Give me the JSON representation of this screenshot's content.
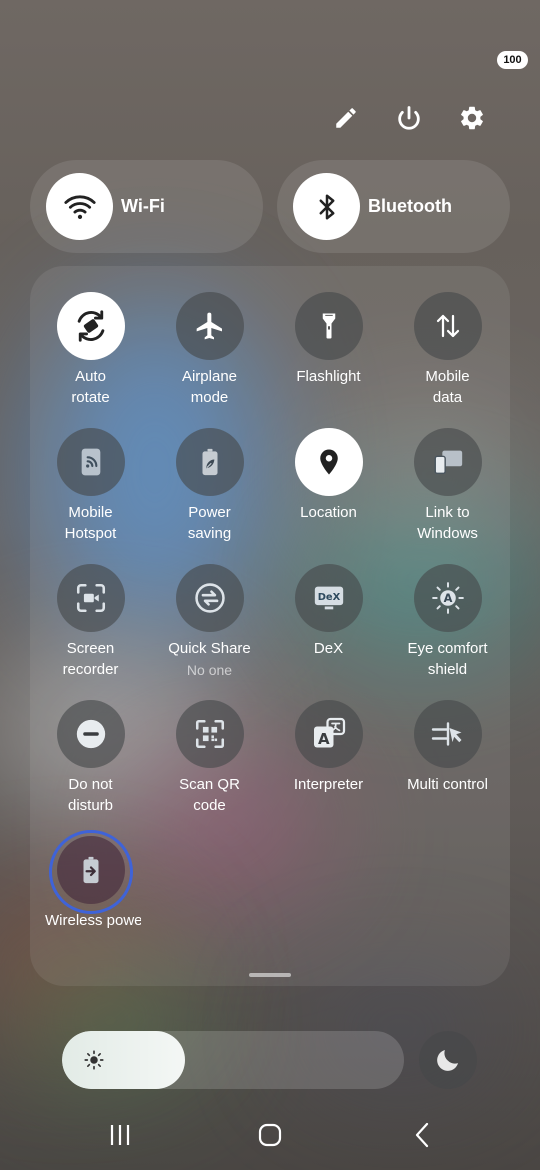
{
  "status": {
    "battery": "100"
  },
  "header_icons": [
    "pencil-icon",
    "power-icon",
    "gear-icon"
  ],
  "wifi": {
    "label": "Wi-Fi",
    "icon": "wifi-icon",
    "on": true
  },
  "bluetooth": {
    "label": "Bluetooth",
    "icon": "bluetooth-icon",
    "on": true
  },
  "tiles": [
    {
      "id": "auto-rotate",
      "label": "Auto\nrotate",
      "icon": "auto-rotate-icon",
      "on": true
    },
    {
      "id": "airplane-mode",
      "label": "Airplane\nmode",
      "icon": "airplane-icon",
      "on": false
    },
    {
      "id": "flashlight",
      "label": "Flashlight",
      "icon": "flashlight-icon",
      "on": false
    },
    {
      "id": "mobile-data",
      "label": "Mobile\ndata",
      "icon": "mobile-data-icon",
      "on": false
    },
    {
      "id": "mobile-hotspot",
      "label": "Mobile\nHotspot",
      "icon": "hotspot-icon",
      "on": false
    },
    {
      "id": "power-saving",
      "label": "Power\nsaving",
      "icon": "battery-leaf-icon",
      "on": false
    },
    {
      "id": "location",
      "label": "Location",
      "icon": "location-pin-icon",
      "on": true
    },
    {
      "id": "link-to-windows",
      "label": "Link to\nWindows",
      "icon": "link-windows-icon",
      "on": false
    },
    {
      "id": "screen-recorder",
      "label": "Screen\nrecorder",
      "icon": "screen-recorder-icon",
      "on": false
    },
    {
      "id": "quick-share",
      "label": "Quick Share",
      "sub": "No one",
      "icon": "quick-share-icon",
      "on": false
    },
    {
      "id": "dex",
      "label": "DeX",
      "icon": "dex-icon",
      "on": false
    },
    {
      "id": "eye-comfort",
      "label": "Eye comfort\nshield",
      "icon": "eye-comfort-icon",
      "on": false
    },
    {
      "id": "do-not-disturb",
      "label": "Do not\ndisturb",
      "icon": "do-not-disturb-icon",
      "on": false
    },
    {
      "id": "scan-qr",
      "label": "Scan QR\ncode",
      "icon": "qr-code-icon",
      "on": false
    },
    {
      "id": "interpreter",
      "label": "Interpreter",
      "icon": "interpreter-icon",
      "on": false
    },
    {
      "id": "multi-control",
      "label": "Multi control",
      "icon": "multi-control-icon",
      "on": false
    },
    {
      "id": "wireless-power",
      "label": "Wireless powe",
      "icon": "wireless-power-share-icon",
      "on": false
    }
  ],
  "brightness": {
    "level": 0.36,
    "icon": "sun-icon"
  },
  "night_mode": {
    "icon": "moon-icon"
  },
  "nav": [
    "recents-icon",
    "home-icon",
    "back-icon"
  ],
  "colors": {
    "accent_focus": "#3f63d8",
    "tile_on": "#ffffff",
    "tile_off": "#46484a"
  }
}
